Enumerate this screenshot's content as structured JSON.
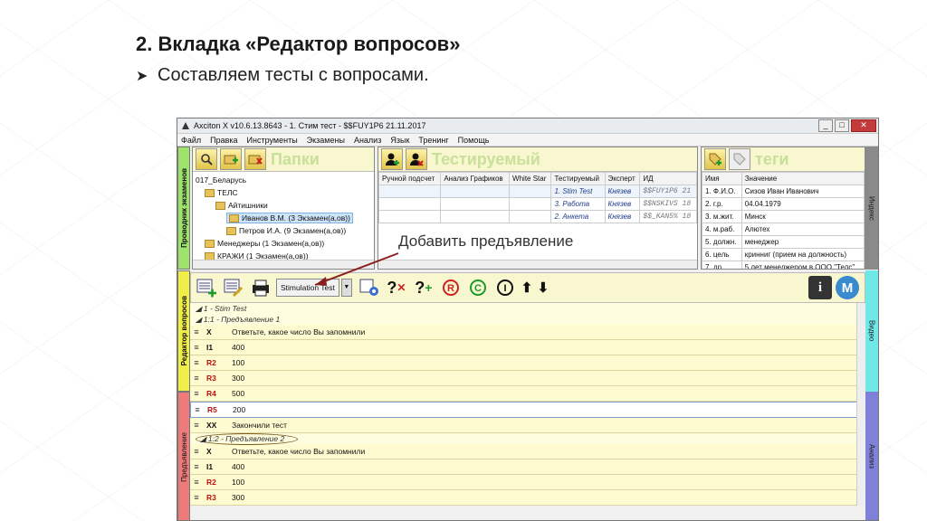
{
  "slide": {
    "title": "2. Вкладка «Редактор вопросов»",
    "bullet": "Составляем тесты с вопросами."
  },
  "window": {
    "title": "Axciton X v10.6.13.8643 - 1. Стим тест - $$FUY1P6 21.11.2017",
    "menu": [
      "Файл",
      "Правка",
      "Инструменты",
      "Экзамены",
      "Анализ",
      "Язык",
      "Тренинг",
      "Помощь"
    ]
  },
  "side_tabs": {
    "explorer": "Проводник экзаменов",
    "editor": "Редактор вопросов",
    "presentation": "Предъявление"
  },
  "right_tabs": {
    "index": "Индекс",
    "video": "Видео",
    "analysis": "Анализ"
  },
  "folders": {
    "label": "Папки",
    "tree": [
      {
        "text": "017_Беларусь",
        "level": 0
      },
      {
        "text": "ТЕЛС",
        "level": 1
      },
      {
        "text": "Айтишники",
        "level": 2
      },
      {
        "text": "Иванов В.М. (3 Экзамен(а,ов))",
        "level": 3,
        "selected": true
      },
      {
        "text": "Петров И.А. (9 Экзамен(а,ов))",
        "level": 3
      },
      {
        "text": "Менеджеры (1 Экзамен(а,ов))",
        "level": 1
      },
      {
        "text": "КРАЖИ (1 Экзамен(а,ов))",
        "level": 1
      }
    ]
  },
  "subject": {
    "label": "Тестируемый",
    "columns": [
      "Ручной подсчет",
      "Анализ Графиков",
      "White Star",
      "Тестируемый",
      "Эксперт",
      "ИД"
    ],
    "rows": [
      {
        "test": "1. Stim Test",
        "expert": "Князев",
        "id": "$$FUY1P6",
        "n": "21"
      },
      {
        "test": "3. Работа",
        "expert": "Князев",
        "id": "$$NSKIVS",
        "n": "18"
      },
      {
        "test": "2. Анкета",
        "expert": "Князев",
        "id": "$$_KAN5%",
        "n": "18"
      }
    ]
  },
  "tags": {
    "label": "теги",
    "columns": [
      "Имя",
      "Значение"
    ],
    "rows": [
      {
        "name": "1. Ф.И.О.",
        "value": "Сизов Иван Иванович"
      },
      {
        "name": "2. г.р.",
        "value": "04.04.1979"
      },
      {
        "name": "3. м.жит.",
        "value": "Минск"
      },
      {
        "name": "4. м.раб.",
        "value": "Алютех"
      },
      {
        "name": "5. должн.",
        "value": "менеджер"
      },
      {
        "name": "6. цель",
        "value": "кринниг (прием на должность)"
      },
      {
        "name": "7. др.",
        "value": "5 лет менеджером в ООО \"Телс\""
      }
    ]
  },
  "annotation": "Добавить предъявление",
  "editor": {
    "stimulation_combo": "Stimulation Test",
    "scroll_thumb": "III",
    "group_test": "1 - Stim Test",
    "group_pres1": "1:1 - Предъявление 1",
    "group_pres2": "1:2 - Предъявление 2",
    "rows1": [
      {
        "code": "X",
        "text": "Ответьте, какое число Вы запомнили",
        "red": false
      },
      {
        "code": "I1",
        "text": "400",
        "red": false
      },
      {
        "code": "R2",
        "text": "100",
        "red": true
      },
      {
        "code": "R3",
        "text": "300",
        "red": true
      },
      {
        "code": "R4",
        "text": "500",
        "red": true
      },
      {
        "code": "R5",
        "text": "200",
        "red": true
      },
      {
        "code": "XX",
        "text": "Закончили тест",
        "red": false
      }
    ],
    "rows2": [
      {
        "code": "X",
        "text": "Ответьте, какое число Вы запомнили",
        "red": false
      },
      {
        "code": "I1",
        "text": "400",
        "red": false
      },
      {
        "code": "R2",
        "text": "100",
        "red": true
      },
      {
        "code": "R3",
        "text": "300",
        "red": true
      }
    ]
  }
}
